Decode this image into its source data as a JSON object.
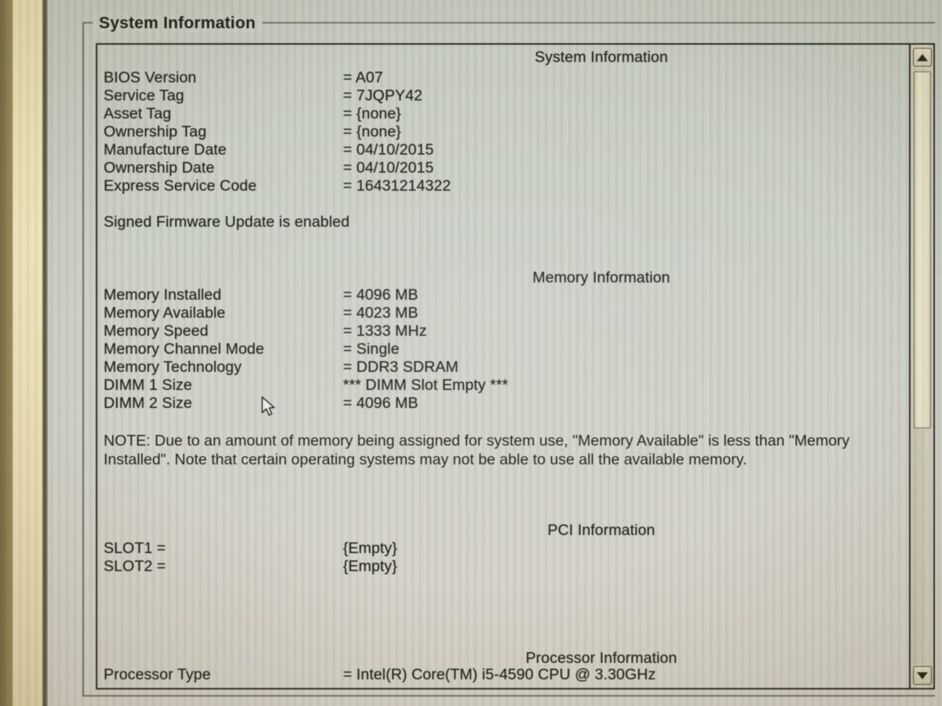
{
  "window": {
    "groupbox_title": "System Information"
  },
  "sections": [
    {
      "heading": "System Information",
      "rows": [
        {
          "label": "BIOS Version",
          "value": "= A07"
        },
        {
          "label": "Service Tag",
          "value": "= 7JQPY42"
        },
        {
          "label": "Asset Tag",
          "value": "= {none}"
        },
        {
          "label": "Ownership Tag",
          "value": "= {none}"
        },
        {
          "label": "Manufacture Date",
          "value": "= 04/10/2015"
        },
        {
          "label": "Ownership Date",
          "value": "= 04/10/2015"
        },
        {
          "label": "Express Service Code",
          "value": "= 16431214322"
        }
      ],
      "status_line": "Signed Firmware Update is enabled"
    },
    {
      "heading": "Memory Information",
      "rows": [
        {
          "label": "Memory Installed",
          "value": "= 4096 MB"
        },
        {
          "label": "Memory Available",
          "value": "= 4023 MB"
        },
        {
          "label": "Memory Speed",
          "value": "= 1333 MHz"
        },
        {
          "label": "Memory Channel Mode",
          "value": "= Single"
        },
        {
          "label": "Memory Technology",
          "value": "= DDR3 SDRAM"
        },
        {
          "label": "DIMM 1 Size",
          "value": "*** DIMM Slot Empty ***"
        },
        {
          "label": "DIMM 2 Size",
          "value": "= 4096 MB"
        }
      ],
      "note": "NOTE: Due to an amount of memory being assigned for system use, \"Memory Available\" is less than \"Memory Installed\". Note that certain operating systems may not be able to use all the available memory."
    },
    {
      "heading": "PCI Information",
      "rows": [
        {
          "label": "SLOT1 =",
          "value": "{Empty}"
        },
        {
          "label": "SLOT2 =",
          "value": "{Empty}"
        }
      ]
    },
    {
      "heading": "Processor Information",
      "rows": [
        {
          "label": "Processor Type",
          "value": "= Intel(R) Core(TM) i5-4590 CPU @ 3.30GHz"
        }
      ]
    }
  ],
  "scrollbar": {
    "up_icon": "triangle-up-icon",
    "down_icon": "triangle-down-icon"
  },
  "cursor": {
    "icon": "arrow-pointer-icon"
  },
  "colors": {
    "background": "#c9cec4",
    "text": "#14160f",
    "panel_border": "#20231b",
    "scrollbar_thumb": "#e1dbbe"
  }
}
